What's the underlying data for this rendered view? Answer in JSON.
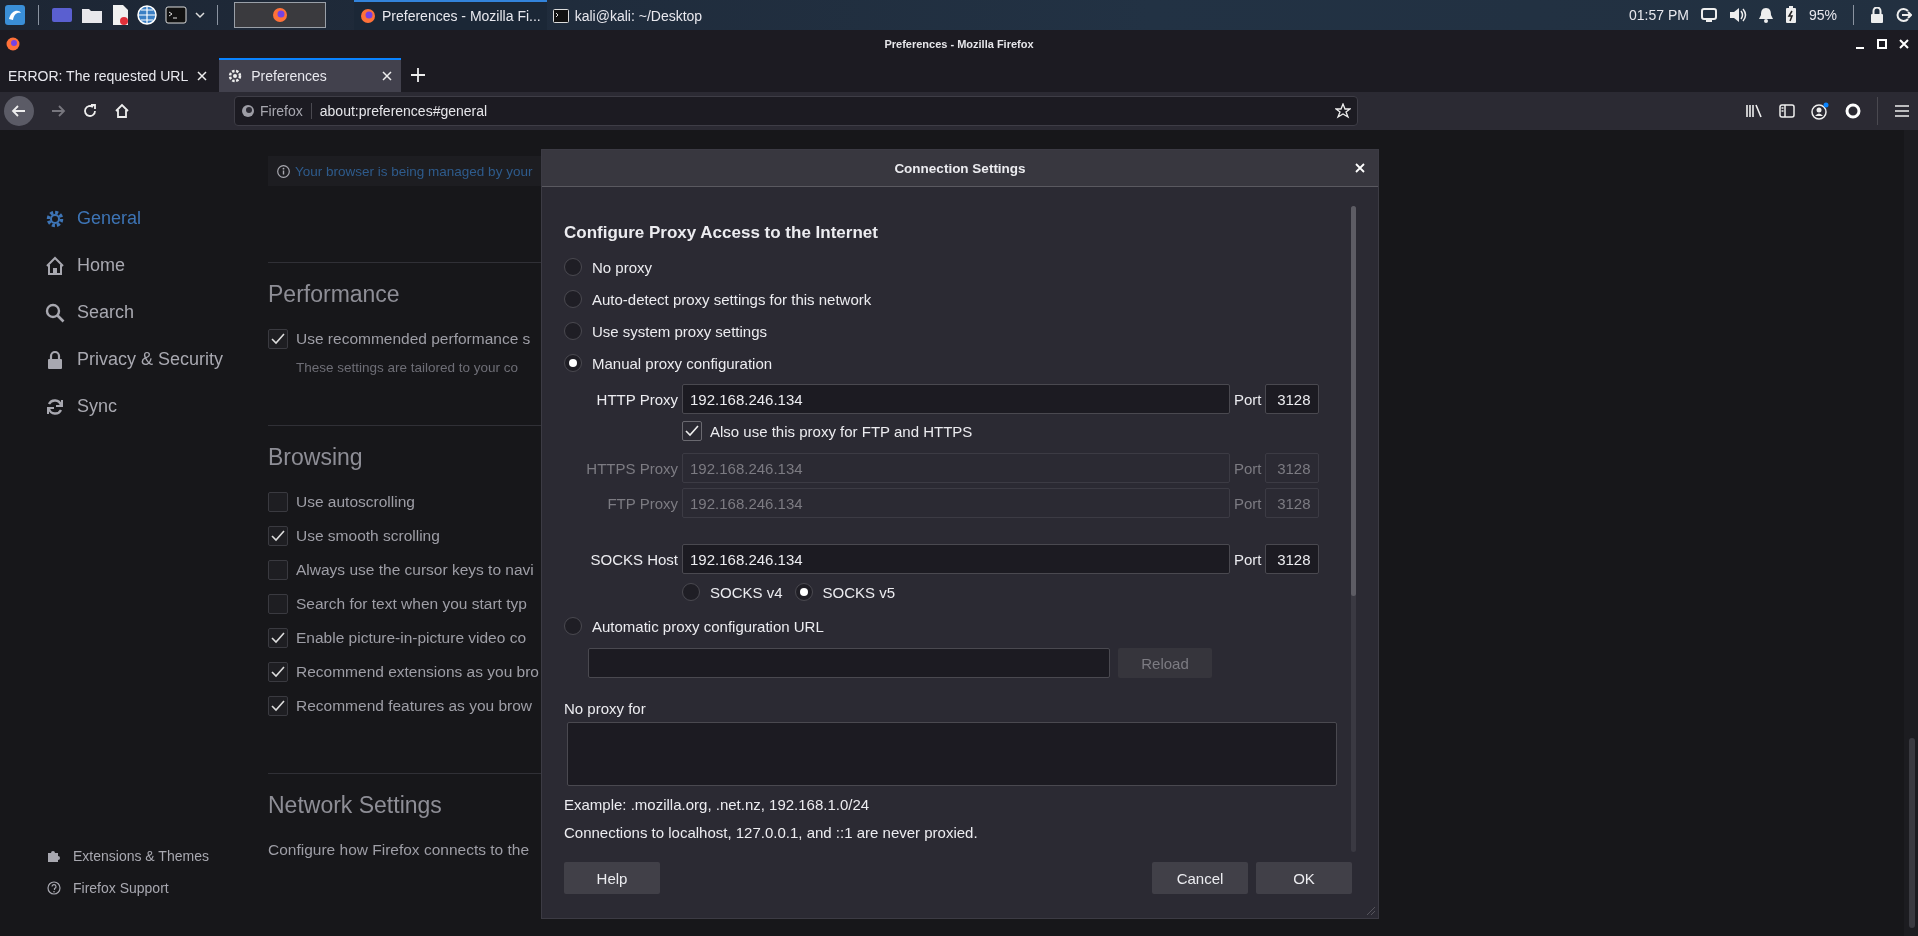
{
  "taskbar": {
    "windows": [
      {
        "label": "Preferences - Mozilla Fi...",
        "selected": true
      },
      {
        "label": "kali@kali: ~/Desktop",
        "selected": false
      }
    ],
    "clock": "01:57 PM",
    "battery": "95%"
  },
  "window": {
    "title": "Preferences - Mozilla Firefox"
  },
  "tabs": [
    {
      "label": "ERROR: The requested URL",
      "selected": false
    },
    {
      "label": "Preferences",
      "selected": true
    }
  ],
  "url_bar": {
    "identity": "Firefox",
    "value": "about:preferences#general"
  },
  "sidebar": {
    "items": [
      {
        "label": "General",
        "selected": true
      },
      {
        "label": "Home",
        "selected": false
      },
      {
        "label": "Search",
        "selected": false
      },
      {
        "label": "Privacy & Security",
        "selected": false
      },
      {
        "label": "Sync",
        "selected": false
      }
    ],
    "footer": [
      "Extensions & Themes",
      "Firefox Support"
    ]
  },
  "notice": "Your browser is being managed by your",
  "sections": [
    {
      "heading": "Performance",
      "rows": [
        {
          "kind": "checkbox",
          "label": "Use recommended performance s",
          "checked": true
        },
        {
          "kind": "note",
          "label": "These settings are tailored to your co"
        }
      ]
    },
    {
      "heading": "Browsing",
      "rows": [
        {
          "kind": "checkbox",
          "label": "Use autoscrolling",
          "checked": false
        },
        {
          "kind": "checkbox",
          "label": "Use smooth scrolling",
          "checked": true
        },
        {
          "kind": "checkbox",
          "label": "Always use the cursor keys to navi",
          "checked": false
        },
        {
          "kind": "checkbox",
          "label": "Search for text when you start typ",
          "checked": false
        },
        {
          "kind": "checkbox",
          "label": "Enable picture-in-picture video co",
          "checked": true
        },
        {
          "kind": "checkbox",
          "label": "Recommend extensions as you bro",
          "checked": true
        },
        {
          "kind": "checkbox",
          "label": "Recommend features as you brow",
          "checked": true
        }
      ]
    },
    {
      "heading": "Network Settings",
      "rows": [
        {
          "kind": "text",
          "label": "Configure how Firefox connects to the"
        }
      ]
    }
  ],
  "dialog": {
    "title": "Connection Settings",
    "heading": "Configure Proxy Access to the Internet",
    "modes": [
      {
        "label": "No proxy",
        "selected": false
      },
      {
        "label": "Auto-detect proxy settings for this network",
        "selected": false
      },
      {
        "label": "Use system proxy settings",
        "selected": false
      },
      {
        "label": "Manual proxy configuration",
        "selected": true
      },
      {
        "label": "Automatic proxy configuration URL",
        "selected": false
      }
    ],
    "proxies": [
      {
        "label": "HTTP Proxy",
        "value": "192.168.246.134",
        "port_label": "Port",
        "port": "3128",
        "disabled": false
      },
      {
        "label": "HTTPS Proxy",
        "value": "192.168.246.134",
        "port_label": "Port",
        "port": "3128",
        "disabled": true
      },
      {
        "label": "FTP Proxy",
        "value": "192.168.246.134",
        "port_label": "Port",
        "port": "3128",
        "disabled": true
      },
      {
        "label": "SOCKS Host",
        "value": "192.168.246.134",
        "port_label": "Port",
        "port": "3128",
        "disabled": false
      }
    ],
    "share": {
      "label": "Also use this proxy for FTP and HTTPS",
      "checked": true
    },
    "socks_versions": [
      {
        "label": "SOCKS v4",
        "selected": false
      },
      {
        "label": "SOCKS v5",
        "selected": true
      }
    ],
    "reload": {
      "label": "Reload",
      "disabled": true
    },
    "no_proxy_label": "No proxy for",
    "example": "Example: .mozilla.org, .net.nz, 192.168.1.0/24",
    "note": "Connections to localhost, 127.0.0.1, and ::1 are never proxied.",
    "buttons": [
      "Help",
      "Cancel",
      "OK"
    ]
  }
}
